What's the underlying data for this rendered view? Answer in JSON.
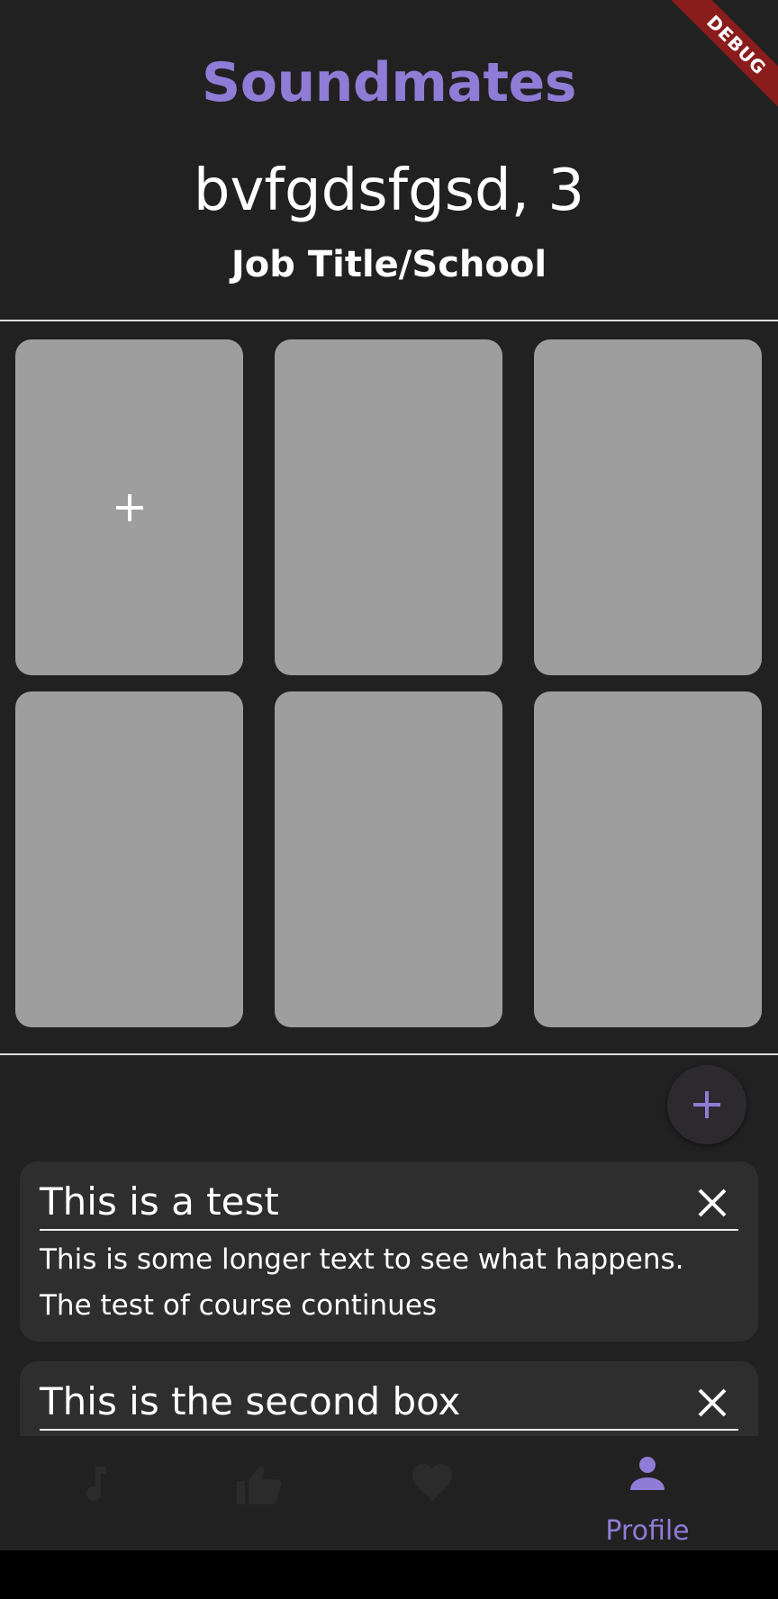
{
  "app": {
    "title": "Soundmates",
    "debug_banner": "DEBUG"
  },
  "profile": {
    "name_age": "bvfgdsfgsd, 3",
    "job": "Job Title/School"
  },
  "photos": {
    "add_icon": "plus-icon",
    "count": 6
  },
  "prompts": {
    "add_icon": "plus-icon",
    "cards": [
      {
        "title": "This is a test",
        "body": "This is some longer text to see what happens. The test of course continues",
        "close_icon": "close-icon"
      },
      {
        "title": "This is the second box",
        "body": "",
        "close_icon": "close-icon"
      }
    ]
  },
  "nav": {
    "items": [
      {
        "icon": "music-note-icon",
        "label": "",
        "active": false
      },
      {
        "icon": "thumbs-up-icon",
        "label": "",
        "active": false
      },
      {
        "icon": "heart-icon",
        "label": "",
        "active": false
      },
      {
        "icon": "person-icon",
        "label": "Profile",
        "active": true
      }
    ]
  },
  "colors": {
    "accent": "#8e7cd6",
    "background": "#212121",
    "tile": "#9e9e9e",
    "card": "#2e2e2e",
    "inactive_icon": "#2b2b2b",
    "debug_ribbon": "#8a1c1c"
  }
}
